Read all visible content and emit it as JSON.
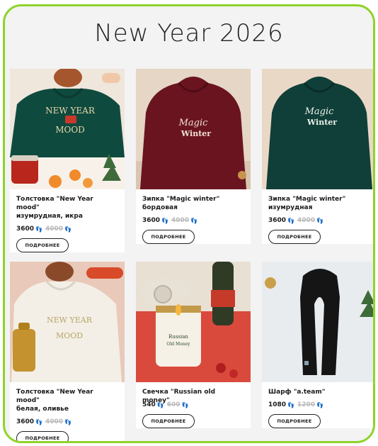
{
  "page": {
    "title": "New Year 2026"
  },
  "products": [
    {
      "name_line1": "Толстовка \"New Year mood\"",
      "name_line2": "изумрудная, икра",
      "price": "3600",
      "old_price": "4000",
      "button": "ПОДРОБНЕЕ",
      "print_text": [
        "NEW YEAR",
        "MOOD"
      ],
      "colors": {
        "garment": "#0f4a3f",
        "bg": "#efe6dc"
      }
    },
    {
      "name_line1": "Зипка \"Magic winter\"",
      "name_line2": "бордовая",
      "price": "3600",
      "old_price": "4000",
      "button": "ПОДРОБНЕЕ",
      "print_text": [
        "Magic",
        "Winter"
      ],
      "colors": {
        "garment": "#6a1420",
        "bg": "#e6d6c5"
      }
    },
    {
      "name_line1": "Зипка \"Magic winter\"",
      "name_line2": "изумрудная",
      "price": "3600",
      "old_price": "4000",
      "button": "ПОДРОБНЕЕ",
      "print_text": [
        "Magic",
        "Winter"
      ],
      "colors": {
        "garment": "#0f3f38",
        "bg": "#ead8c6"
      }
    },
    {
      "name_line1": "Толстовка \"New Year mood\"",
      "name_line2": "белая, оливье",
      "price": "3600",
      "old_price": "4000",
      "button": "ПОДРОБНЕЕ",
      "print_text": [
        "NEW YEAR",
        "MOOD"
      ],
      "colors": {
        "garment": "#f3efe6",
        "bg": "#e9c9b9"
      }
    },
    {
      "name_line1": "Свечка \"Russian old money\"",
      "name_line2": "",
      "price": "540",
      "old_price": "600",
      "button": "ПОДРОБНЕЕ",
      "print_text": [
        "Russian",
        "Old Money"
      ],
      "colors": {
        "garment": "#c8372e",
        "bg": "#d94a3d"
      }
    },
    {
      "name_line1": "Шарф \"a.team\"",
      "name_line2": "",
      "price": "1080",
      "old_price": "1200",
      "button": "ПОДРОБНЕЕ",
      "print_text": [],
      "colors": {
        "garment": "#151515",
        "bg": "#e9ecef"
      }
    }
  ],
  "icons": {
    "currency": "footprints-icon"
  },
  "colors": {
    "accent_border": "#8fd32a",
    "background": "#f3f3f3"
  }
}
